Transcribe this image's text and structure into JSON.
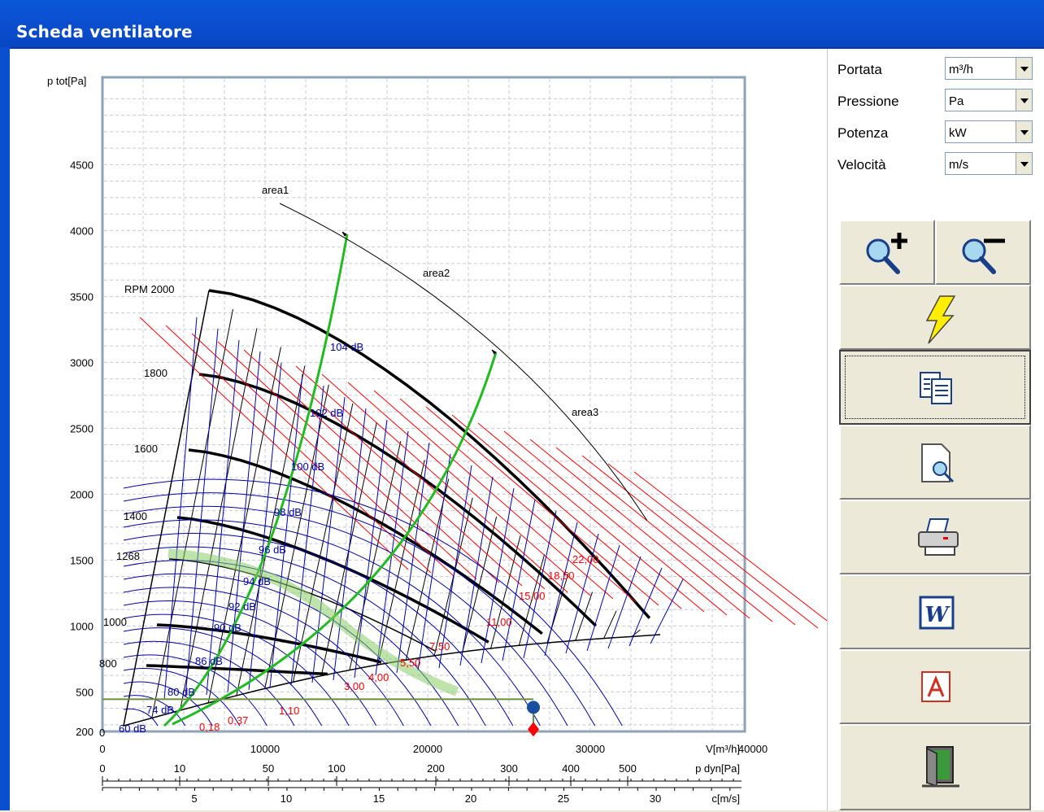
{
  "window": {
    "title": "Scheda ventilatore"
  },
  "units": [
    {
      "label": "Portata",
      "value": "m³/h"
    },
    {
      "label": "Pressione",
      "value": "Pa"
    },
    {
      "label": "Potenza",
      "value": "kW"
    },
    {
      "label": "Velocità",
      "value": "m/s"
    }
  ],
  "toolbar": {
    "zoom_in_icon": "zoom-in-icon",
    "zoom_out_icon": "zoom-out-icon",
    "buttons": [
      "lightning-icon",
      "copy-document-icon",
      "print-preview-icon",
      "printer-icon",
      "word-icon",
      "pdf-icon",
      "exit-door-icon"
    ]
  },
  "chart_data": {
    "type": "fan-performance-map",
    "ylabel": "p tot[Pa]",
    "xlabel": "V[m³/h]",
    "x2label": "p dyn[Pa]",
    "x3label": "c[m/s]",
    "y_ticks": [
      "4500",
      "4000",
      "3500",
      "3000",
      "2500",
      "2000",
      "1500",
      "1000",
      "500",
      "200"
    ],
    "x_ticks": [
      "0",
      "10000",
      "20000",
      "30000",
      "40000"
    ],
    "x2_ticks": [
      "0",
      "10",
      "50",
      "100",
      "200",
      "300",
      "400",
      "500"
    ],
    "x3_ticks": [
      "5",
      "10",
      "15",
      "20",
      "25",
      "30"
    ],
    "rpm_labels": [
      "RPM 2000",
      "1800",
      "1600",
      "1400",
      "1268",
      "1000",
      "800",
      "0"
    ],
    "db_labels": [
      "104 dB",
      "102 dB",
      "100 dB",
      "98 dB",
      "96 dB",
      "94 dB",
      "92 dB",
      "90 dB",
      "86 dB",
      "80 dB",
      "74 dB",
      "60 dB"
    ],
    "power_labels": [
      "22,00",
      "18,50",
      "15,00",
      "11,00",
      "7,50",
      "5,50",
      "4,00",
      "3,00",
      "1,10",
      "0,37",
      "0,18"
    ],
    "area_labels": [
      "area1",
      "area2",
      "area3"
    ],
    "operating_point": {
      "flow": 26500,
      "pressure": 420
    },
    "colors": {
      "rpm": "#000000",
      "power": "#ff0000",
      "noise": "#0000aa",
      "area": "#22bb22",
      "grid": "#c8c8dc",
      "point": "#1a4fa0",
      "marker": "#ff0000"
    }
  }
}
